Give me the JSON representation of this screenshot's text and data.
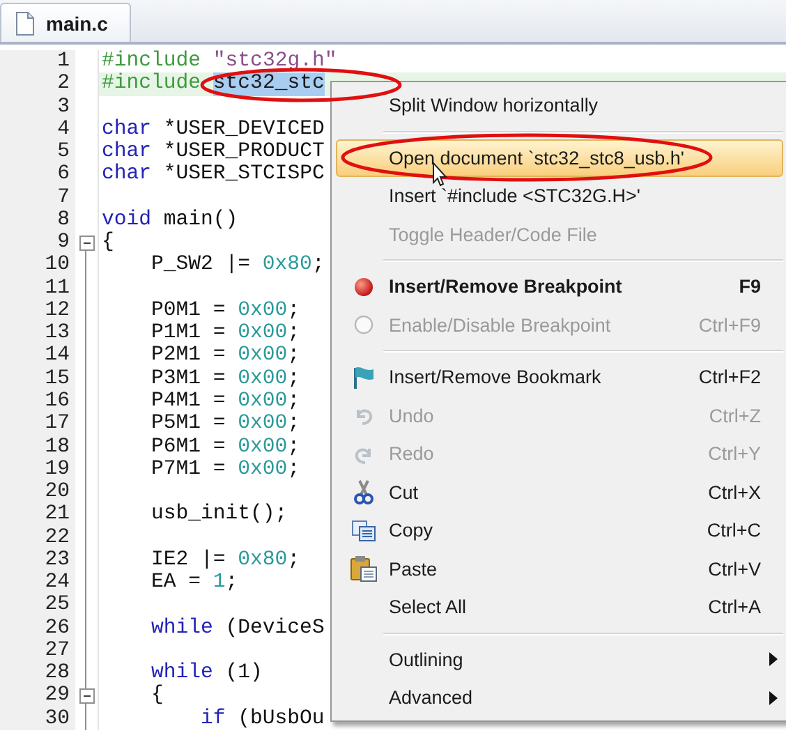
{
  "tab": {
    "label": "main.c",
    "selected": true
  },
  "lines": [
    {
      "number": "1",
      "tokens": [
        {
          "kind": "preproc",
          "s": "#include"
        },
        {
          "kind": "string",
          "s": "\"stc32g.h\""
        }
      ]
    },
    {
      "number": "2",
      "current": true,
      "tokens": [
        {
          "kind": "preproc",
          "s": "#include"
        },
        {
          "kind": "selected",
          "s": "stc32_stc"
        }
      ]
    },
    {
      "number": "3"
    },
    {
      "number": "4",
      "tokens": [
        {
          "kind": "keyword",
          "s": "char"
        },
        {
          "kind": "text",
          "s": "*USER_DEVICED"
        }
      ]
    },
    {
      "number": "5",
      "tokens": [
        {
          "kind": "keyword",
          "s": "char"
        },
        {
          "kind": "text",
          "s": "*USER_PRODUCT"
        }
      ]
    },
    {
      "number": "6",
      "tokens": [
        {
          "kind": "keyword",
          "s": "char"
        },
        {
          "kind": "text",
          "s": "*USER_STCISPC"
        }
      ]
    },
    {
      "number": "7"
    },
    {
      "number": "8",
      "tokens": [
        {
          "kind": "keyword",
          "s": "void"
        },
        {
          "kind": "text",
          "s": "main()"
        }
      ]
    },
    {
      "number": "9",
      "foldable": true,
      "tokens": [
        {
          "kind": "text",
          "s": "{"
        }
      ],
      "children": [
        {
          "number": "10",
          "tokens": [
            {
              "kind": "text",
              "s": "P_SW2 |="
            },
            {
              "kind": "number",
              "s": "0x80"
            },
            {
              "kind": "punct",
              "s": ";"
            }
          ]
        },
        {
          "number": "11"
        },
        {
          "number": "12",
          "tokens": [
            {
              "kind": "text",
              "s": "P0M1 ="
            },
            {
              "kind": "number",
              "s": "0x00"
            },
            {
              "kind": "punct",
              "s": ";"
            }
          ]
        },
        {
          "number": "13",
          "tokens": [
            {
              "kind": "text",
              "s": "P1M1 ="
            },
            {
              "kind": "number",
              "s": "0x00"
            },
            {
              "kind": "punct",
              "s": ";"
            }
          ]
        },
        {
          "number": "14",
          "tokens": [
            {
              "kind": "text",
              "s": "P2M1 ="
            },
            {
              "kind": "number",
              "s": "0x00"
            },
            {
              "kind": "punct",
              "s": ";"
            }
          ]
        },
        {
          "number": "15",
          "tokens": [
            {
              "kind": "text",
              "s": "P3M1 ="
            },
            {
              "kind": "number",
              "s": "0x00"
            },
            {
              "kind": "punct",
              "s": ";"
            }
          ]
        },
        {
          "number": "16",
          "tokens": [
            {
              "kind": "text",
              "s": "P4M1 ="
            },
            {
              "kind": "number",
              "s": "0x00"
            },
            {
              "kind": "punct",
              "s": ";"
            }
          ]
        },
        {
          "number": "17",
          "tokens": [
            {
              "kind": "text",
              "s": "P5M1 ="
            },
            {
              "kind": "number",
              "s": "0x00"
            },
            {
              "kind": "punct",
              "s": ";"
            }
          ]
        },
        {
          "number": "18",
          "tokens": [
            {
              "kind": "text",
              "s": "P6M1 ="
            },
            {
              "kind": "number",
              "s": "0x00"
            },
            {
              "kind": "punct",
              "s": ";"
            }
          ]
        },
        {
          "number": "19",
          "tokens": [
            {
              "kind": "text",
              "s": "P7M1 ="
            },
            {
              "kind": "number",
              "s": "0x00"
            },
            {
              "kind": "punct",
              "s": ";"
            }
          ]
        },
        {
          "number": "20"
        },
        {
          "number": "21",
          "tokens": [
            {
              "kind": "text",
              "s": "usb_init();"
            }
          ]
        },
        {
          "number": "22"
        },
        {
          "number": "23",
          "tokens": [
            {
              "kind": "text",
              "s": "IE2 |="
            },
            {
              "kind": "number",
              "s": "0x80"
            },
            {
              "kind": "punct",
              "s": ";"
            }
          ]
        },
        {
          "number": "24",
          "tokens": [
            {
              "kind": "text",
              "s": "EA ="
            },
            {
              "kind": "number",
              "s": "1"
            },
            {
              "kind": "punct",
              "s": ";"
            }
          ]
        },
        {
          "number": "25"
        },
        {
          "number": "26",
          "tokens": [
            {
              "kind": "keyword",
              "s": "while"
            },
            {
              "kind": "text",
              "s": "(DeviceS"
            }
          ]
        },
        {
          "number": "27"
        },
        {
          "number": "28",
          "tokens": [
            {
              "kind": "keyword",
              "s": "while"
            },
            {
              "kind": "text",
              "s": "(1)"
            }
          ]
        },
        {
          "number": "29",
          "foldable": true,
          "tokens": [
            {
              "kind": "text",
              "s": "{"
            }
          ],
          "children": [
            {
              "number": "30",
              "tokens": [
                {
                  "kind": "keyword",
                  "s": "if"
                },
                {
                  "kind": "text",
                  "s": "(bUsbOu"
                }
              ]
            }
          ]
        }
      ]
    }
  ],
  "context_menu": {
    "items": [
      {
        "kind": "item",
        "label": "Split Window horizontally",
        "selected": false,
        "disabled": false
      },
      {
        "kind": "separator"
      },
      {
        "kind": "item",
        "label": "Open document `stc32_stc8_usb.h'",
        "selected": true,
        "disabled": false
      },
      {
        "kind": "item",
        "label": "Insert `#include <STC32G.H>'",
        "selected": false,
        "disabled": false
      },
      {
        "kind": "item",
        "label": "Toggle Header/Code File",
        "selected": false,
        "disabled": true
      },
      {
        "kind": "separator"
      },
      {
        "kind": "breakpoint",
        "label": "Insert/Remove Breakpoint",
        "shortcut": "F9",
        "bold": true,
        "selected": false,
        "disabled": false
      },
      {
        "kind": "toggle",
        "label": "Enable/Disable Breakpoint",
        "shortcut": "Ctrl+F9",
        "selected": false,
        "disabled": true
      },
      {
        "kind": "separator"
      },
      {
        "kind": "bookmark",
        "label": "Insert/Remove Bookmark",
        "shortcut": "Ctrl+F2",
        "selected": false,
        "disabled": false
      },
      {
        "kind": "undo",
        "label": "Undo",
        "shortcut": "Ctrl+Z",
        "selected": false,
        "disabled": true
      },
      {
        "kind": "redo",
        "label": "Redo",
        "shortcut": "Ctrl+Y",
        "selected": false,
        "disabled": true
      },
      {
        "kind": "cut",
        "label": "Cut",
        "shortcut": "Ctrl+X",
        "selected": false,
        "disabled": false
      },
      {
        "kind": "copy",
        "label": "Copy",
        "shortcut": "Ctrl+C",
        "selected": false,
        "disabled": false
      },
      {
        "kind": "paste",
        "label": "Paste",
        "shortcut": "Ctrl+V",
        "selected": false,
        "disabled": false
      },
      {
        "kind": "item",
        "label": "Select All",
        "shortcut": "Ctrl+A",
        "selected": false,
        "disabled": false
      },
      {
        "kind": "separator"
      },
      {
        "kind": "item",
        "label": "Outlining",
        "submenu": true,
        "selected": false,
        "disabled": false
      },
      {
        "kind": "item",
        "label": "Advanced",
        "submenu": true,
        "selected": false,
        "disabled": false
      }
    ]
  }
}
